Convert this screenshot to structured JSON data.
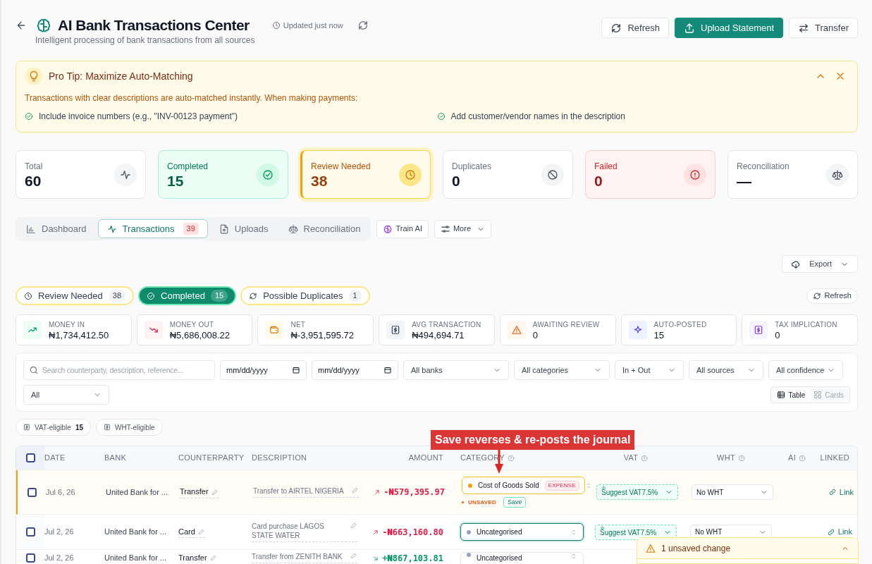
{
  "header": {
    "title": "AI Bank Transactions Center",
    "subtitle": "Intelligent processing of bank transactions from all sources",
    "updated": "Updated just now",
    "buttons": [
      {
        "label": "Refresh",
        "kind": "outline"
      },
      {
        "label": "Upload Statement",
        "kind": "primary"
      },
      {
        "label": "Transfer",
        "kind": "outline"
      }
    ]
  },
  "tip": {
    "title": "Pro Tip: Maximize Auto-Matching",
    "text": "Transactions with clear descriptions are auto-matched instantly. When making payments:",
    "bullets": [
      "Include invoice numbers (e.g., \"INV-00123 payment\")",
      "Add customer/vendor names in the description"
    ]
  },
  "stats": [
    {
      "label": "Total",
      "value": "60",
      "kind": "neutral"
    },
    {
      "label": "Completed",
      "value": "15",
      "kind": "success"
    },
    {
      "label": "Review Needed",
      "value": "38",
      "kind": "warning"
    },
    {
      "label": "Duplicates",
      "value": "0",
      "kind": "neutral"
    },
    {
      "label": "Failed",
      "value": "0",
      "kind": "danger"
    },
    {
      "label": "Reconciliation",
      "value": "—",
      "kind": "neutral"
    }
  ],
  "tabs": [
    {
      "label": "Dashboard",
      "selected": false
    },
    {
      "label": "Transactions",
      "selected": true,
      "badge": "39"
    },
    {
      "label": "Uploads",
      "selected": false
    },
    {
      "label": "Reconciliation",
      "selected": false
    }
  ],
  "tools": [
    "Train AI",
    "More"
  ],
  "export": "Export",
  "status_filters": [
    {
      "label": "Review Needed",
      "count": "38",
      "selected": false
    },
    {
      "label": "Completed",
      "count": "15",
      "selected": true
    },
    {
      "label": "Possible Duplicates",
      "count": "1",
      "selected": false
    }
  ],
  "refresh": "Refresh",
  "metrics": [
    {
      "label": "MONEY IN",
      "value": "₦1,734,412.50",
      "kind": "in"
    },
    {
      "label": "MONEY OUT",
      "value": "₦5,686,008.22",
      "kind": "out"
    },
    {
      "label": "NET",
      "value": "₦-3,951,595.72",
      "kind": "net"
    },
    {
      "label": "AVG TRANSACTION",
      "value": "₦494,694.71",
      "kind": "average"
    },
    {
      "label": "AWAITING REVIEW",
      "value": "0",
      "kind": "awaiting"
    },
    {
      "label": "AUTO-POSTED",
      "value": "15",
      "kind": "auto"
    },
    {
      "label": "TAX IMPLICATION",
      "value": "0",
      "kind": "tax"
    }
  ],
  "filters": {
    "search": {
      "placeholder": "Search counterparty, description, reference..."
    },
    "dates": [
      "mm/dd/yyyy",
      "mm/dd/yyyy"
    ],
    "selects": [
      "All banks",
      "All categories",
      "In + Out",
      "All sources",
      "All confidence",
      "All"
    ],
    "views": [
      {
        "label": "Table",
        "selected": true
      },
      {
        "label": "Cards",
        "selected": false
      }
    ]
  },
  "tax_chips": [
    {
      "label": "VAT-eligible",
      "count": "15"
    },
    {
      "label": "WHT-eligible"
    }
  ],
  "table": {
    "columns": [
      {
        "label": "DATE"
      },
      {
        "label": "BANK"
      },
      {
        "label": "COUNTERPARTY"
      },
      {
        "label": "DESCRIPTION"
      },
      {
        "label": "AMOUNT"
      },
      {
        "label": "CATEGORY",
        "help": true
      },
      {
        "label": "VAT",
        "help": true
      },
      {
        "label": "WHT",
        "help": true
      },
      {
        "label": "AI",
        "help": true
      },
      {
        "label": "LINKED"
      }
    ],
    "header_checked": false,
    "rows": [
      {
        "checked": false,
        "date": "Jul 6, 26",
        "bank": "United Bank for ...",
        "counterparty": "Transfer",
        "description": "Transfer to AIRTEL NIGERIA",
        "amount": "-₦579,395.97",
        "incoming": false,
        "category": "Cost of Goods Sold",
        "color": "#f59e0b",
        "category_type": "EXPENSE",
        "focused": false,
        "unsaved": true,
        "unsaved_label": "UNSAVED",
        "save": "Save",
        "vat": "Suggest VAT7.5%",
        "wht": "No WHT",
        "link": "Link"
      },
      {
        "checked": false,
        "date": "Jul 2, 26",
        "bank": "United Bank for ...",
        "counterparty": "Card",
        "description": "Card purchase LAGOS STATE WATER",
        "amount": "-₦663,160.80",
        "incoming": false,
        "category": "Uncategorised",
        "color": "#94a3b8",
        "focused": true,
        "unsaved": false,
        "vat": "Suggest VAT7.5%",
        "wht": "No WHT",
        "link": "Link"
      },
      {
        "checked": false,
        "date": "Jul 2, 26",
        "bank": "United Bank for ...",
        "counterparty": "Transfer",
        "description": "Transfer from ZENITH BANK",
        "amount": "+₦867,103.81",
        "incoming": true,
        "category": "Uncategorised",
        "color": "#94a3b8",
        "focused": false,
        "unsaved": false
      }
    ]
  },
  "annotation": {
    "text": "Save reverses & re-posts the journal"
  },
  "unsaved_panel": {
    "text": "1 unsaved change"
  }
}
